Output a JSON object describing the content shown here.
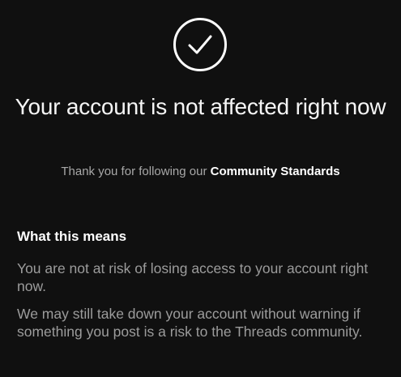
{
  "icons": {
    "status": "check-circle-icon"
  },
  "header": {
    "title": "Your account is not affected right now",
    "subtitle_prefix": "Thank you for following our",
    "subtitle_link": "Community Standards"
  },
  "section": {
    "title": "What this means",
    "paragraphs": [
      "You are not at risk of losing access to your account right now.",
      "We may still take down your account without warning if something you post is a risk to the Threads community."
    ]
  },
  "colors": {
    "background": "#101010",
    "primary_text": "#ffffff",
    "secondary_text": "#a8a8a8"
  }
}
